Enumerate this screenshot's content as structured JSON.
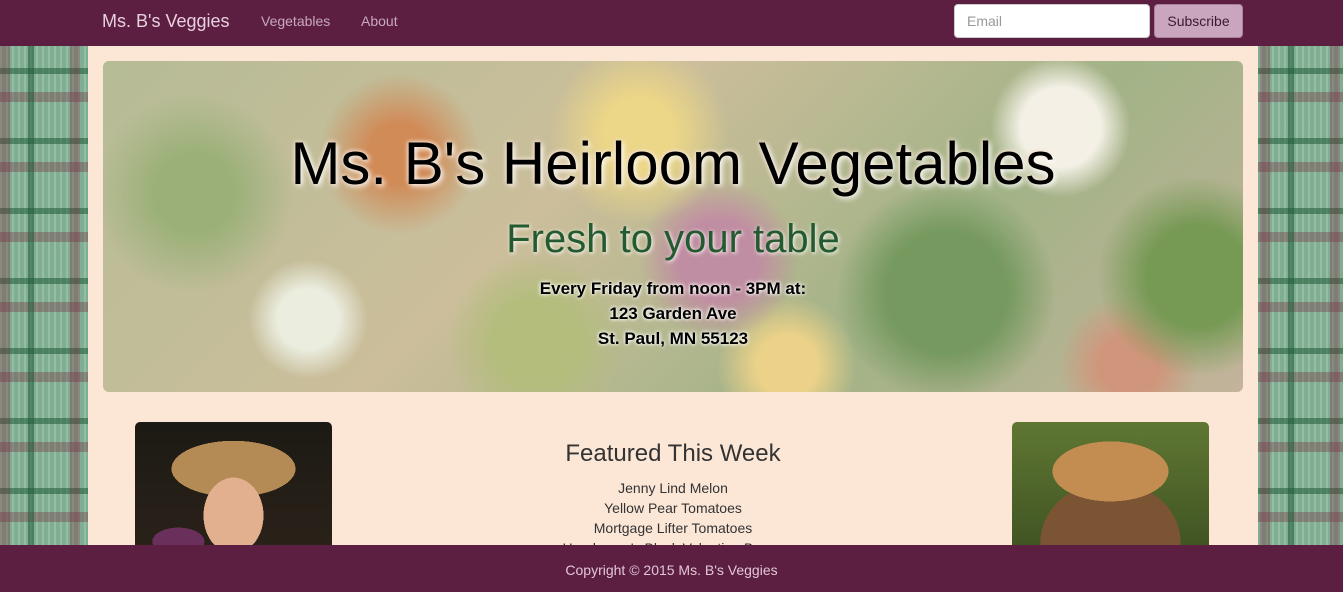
{
  "navbar": {
    "brand": "Ms. B's Veggies",
    "links": [
      "Vegetables",
      "About"
    ],
    "email_placeholder": "Email",
    "subscribe_label": "Subscribe"
  },
  "hero": {
    "title": "Ms. B's Heirloom Vegetables",
    "subtitle": "Fresh to your table",
    "schedule": "Every Friday from noon - 3PM at:",
    "address_line1": "123 Garden Ave",
    "address_line2": "St. Paul, MN 55123"
  },
  "featured": {
    "title": "Featured This Week",
    "items": [
      "Jenny Lind Melon",
      "Yellow Pear Tomatoes",
      "Mortgage Lifter Tomatoes",
      "Henderson's Black Valentine Beans"
    ]
  },
  "footer": {
    "copyright": "Copyright © 2015 Ms. B's Veggies"
  },
  "colors": {
    "nav_background": "#5c1f42",
    "content_background": "#fce7d7",
    "subtitle_green": "#245a30",
    "subscribe_button": "#c9a6bd"
  }
}
